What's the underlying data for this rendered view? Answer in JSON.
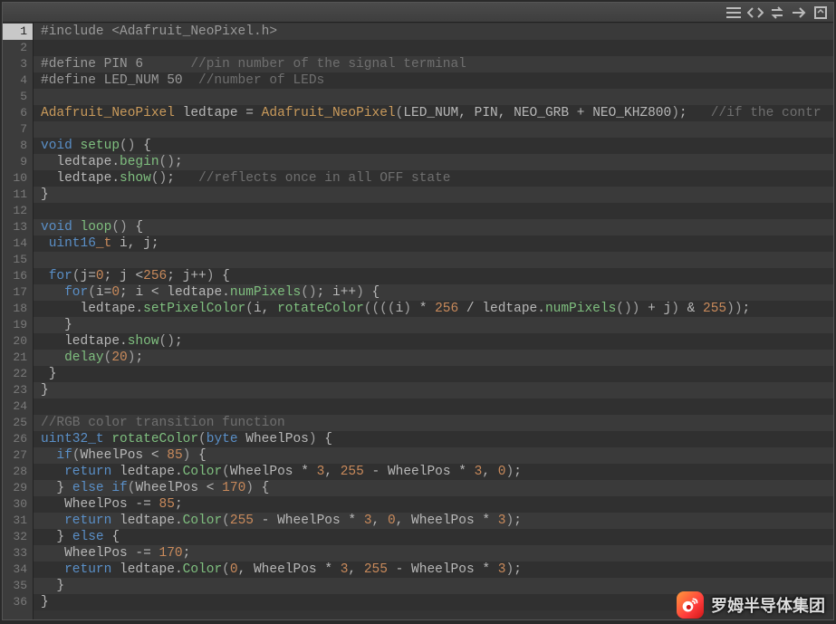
{
  "toolbar": {
    "icons": [
      "hamburger-icon",
      "code-icon",
      "swap-icon",
      "arrow-right-icon",
      "expand-icon"
    ]
  },
  "watermark": {
    "text": "罗姆半导体集团"
  },
  "code": {
    "lines": [
      {
        "n": 1,
        "hl": true,
        "tokens": [
          [
            "directive",
            "#include "
          ],
          [
            "string",
            "<Adafruit_NeoPixel.h>"
          ]
        ]
      },
      {
        "n": 2,
        "tokens": []
      },
      {
        "n": 3,
        "tokens": [
          [
            "directive",
            "#define PIN 6      "
          ],
          [
            "comment",
            "//pin number of the signal terminal"
          ]
        ]
      },
      {
        "n": 4,
        "tokens": [
          [
            "directive",
            "#define LED_NUM 50  "
          ],
          [
            "comment",
            "//number of LEDs"
          ]
        ]
      },
      {
        "n": 5,
        "tokens": []
      },
      {
        "n": 6,
        "tokens": [
          [
            "type",
            "Adafruit_NeoPixel"
          ],
          [
            "ident",
            " ledtape "
          ],
          [
            "op",
            "= "
          ],
          [
            "type",
            "Adafruit_NeoPixel"
          ],
          [
            "paren",
            "("
          ],
          [
            "ident",
            "LED_NUM"
          ],
          [
            "punct",
            ", "
          ],
          [
            "ident",
            "PIN"
          ],
          [
            "punct",
            ", "
          ],
          [
            "ident",
            "NEO_GRB "
          ],
          [
            "op",
            "+ "
          ],
          [
            "ident",
            "NEO_KHZ800"
          ],
          [
            "paren",
            ")"
          ],
          [
            "punct",
            ";   "
          ],
          [
            "comment",
            "//if the contr"
          ]
        ]
      },
      {
        "n": 7,
        "tokens": []
      },
      {
        "n": 8,
        "tokens": [
          [
            "keyword",
            "void"
          ],
          [
            "ident",
            " "
          ],
          [
            "func",
            "setup"
          ],
          [
            "paren",
            "()"
          ],
          [
            "punct",
            " {"
          ]
        ]
      },
      {
        "n": 9,
        "tokens": [
          [
            "ident",
            "  ledtape"
          ],
          [
            "punct",
            "."
          ],
          [
            "method",
            "begin"
          ],
          [
            "paren",
            "()"
          ],
          [
            "punct",
            ";"
          ]
        ]
      },
      {
        "n": 10,
        "tokens": [
          [
            "ident",
            "  ledtape"
          ],
          [
            "punct",
            "."
          ],
          [
            "method",
            "show"
          ],
          [
            "paren",
            "()"
          ],
          [
            "punct",
            ";   "
          ],
          [
            "comment",
            "//reflects once in all OFF state"
          ]
        ]
      },
      {
        "n": 11,
        "tokens": [
          [
            "punct",
            "}"
          ]
        ]
      },
      {
        "n": 12,
        "tokens": []
      },
      {
        "n": 13,
        "tokens": [
          [
            "keyword",
            "void"
          ],
          [
            "ident",
            " "
          ],
          [
            "func",
            "loop"
          ],
          [
            "paren",
            "()"
          ],
          [
            "punct",
            " {"
          ]
        ]
      },
      {
        "n": 14,
        "tokens": [
          [
            "keyword",
            " uint16"
          ],
          [
            "orange",
            "_t"
          ],
          [
            "ident",
            " i"
          ],
          [
            "punct",
            ", "
          ],
          [
            "ident",
            "j"
          ],
          [
            "punct",
            ";"
          ]
        ]
      },
      {
        "n": 15,
        "tokens": []
      },
      {
        "n": 16,
        "tokens": [
          [
            "keyword",
            " for"
          ],
          [
            "paren",
            "("
          ],
          [
            "ident",
            "j"
          ],
          [
            "op",
            "="
          ],
          [
            "number",
            "0"
          ],
          [
            "punct",
            "; "
          ],
          [
            "ident",
            "j "
          ],
          [
            "op",
            "<"
          ],
          [
            "number",
            "256"
          ],
          [
            "punct",
            "; "
          ],
          [
            "ident",
            "j"
          ],
          [
            "op",
            "++"
          ],
          [
            "paren",
            ")"
          ],
          [
            "punct",
            " {"
          ]
        ]
      },
      {
        "n": 17,
        "tokens": [
          [
            "keyword",
            "   for"
          ],
          [
            "paren",
            "("
          ],
          [
            "ident",
            "i"
          ],
          [
            "op",
            "="
          ],
          [
            "number",
            "0"
          ],
          [
            "punct",
            "; "
          ],
          [
            "ident",
            "i "
          ],
          [
            "op",
            "< "
          ],
          [
            "ident",
            "ledtape"
          ],
          [
            "punct",
            "."
          ],
          [
            "method",
            "numPixels"
          ],
          [
            "paren",
            "()"
          ],
          [
            "punct",
            "; "
          ],
          [
            "ident",
            "i"
          ],
          [
            "op",
            "++"
          ],
          [
            "paren",
            ")"
          ],
          [
            "punct",
            " {"
          ]
        ]
      },
      {
        "n": 18,
        "tokens": [
          [
            "ident",
            "     ledtape"
          ],
          [
            "punct",
            "."
          ],
          [
            "method",
            "setPixelColor"
          ],
          [
            "paren",
            "("
          ],
          [
            "ident",
            "i"
          ],
          [
            "punct",
            ", "
          ],
          [
            "method",
            "rotateColor"
          ],
          [
            "paren",
            "(((("
          ],
          [
            "ident",
            "i"
          ],
          [
            "paren",
            ")"
          ],
          [
            "op",
            " * "
          ],
          [
            "number",
            "256"
          ],
          [
            "op",
            " / "
          ],
          [
            "ident",
            "ledtape"
          ],
          [
            "punct",
            "."
          ],
          [
            "method",
            "numPixels"
          ],
          [
            "paren",
            "())"
          ],
          [
            "op",
            " + "
          ],
          [
            "ident",
            "j"
          ],
          [
            "paren",
            ")"
          ],
          [
            "op",
            " & "
          ],
          [
            "number",
            "255"
          ],
          [
            "paren",
            "))"
          ],
          [
            "punct",
            ";"
          ]
        ]
      },
      {
        "n": 19,
        "tokens": [
          [
            "punct",
            "   }"
          ]
        ]
      },
      {
        "n": 20,
        "tokens": [
          [
            "ident",
            "   ledtape"
          ],
          [
            "punct",
            "."
          ],
          [
            "method",
            "show"
          ],
          [
            "paren",
            "()"
          ],
          [
            "punct",
            ";"
          ]
        ]
      },
      {
        "n": 21,
        "tokens": [
          [
            "ident",
            "   "
          ],
          [
            "method",
            "delay"
          ],
          [
            "paren",
            "("
          ],
          [
            "number",
            "20"
          ],
          [
            "paren",
            ")"
          ],
          [
            "punct",
            ";"
          ]
        ]
      },
      {
        "n": 22,
        "tokens": [
          [
            "punct",
            " }"
          ]
        ]
      },
      {
        "n": 23,
        "tokens": [
          [
            "punct",
            "}"
          ]
        ]
      },
      {
        "n": 24,
        "tokens": []
      },
      {
        "n": 25,
        "tokens": [
          [
            "comment",
            "//RGB color transition function"
          ]
        ]
      },
      {
        "n": 26,
        "tokens": [
          [
            "keyword",
            "uint32_t"
          ],
          [
            "ident",
            " "
          ],
          [
            "func",
            "rotateColor"
          ],
          [
            "paren",
            "("
          ],
          [
            "keyword",
            "byte"
          ],
          [
            "ident",
            " WheelPos"
          ],
          [
            "paren",
            ")"
          ],
          [
            "punct",
            " {"
          ]
        ]
      },
      {
        "n": 27,
        "tokens": [
          [
            "keyword",
            "  if"
          ],
          [
            "paren",
            "("
          ],
          [
            "ident",
            "WheelPos "
          ],
          [
            "op",
            "< "
          ],
          [
            "number",
            "85"
          ],
          [
            "paren",
            ")"
          ],
          [
            "punct",
            " {"
          ]
        ]
      },
      {
        "n": 28,
        "tokens": [
          [
            "keyword",
            "   return"
          ],
          [
            "ident",
            " ledtape"
          ],
          [
            "punct",
            "."
          ],
          [
            "method",
            "Color"
          ],
          [
            "paren",
            "("
          ],
          [
            "ident",
            "WheelPos "
          ],
          [
            "op",
            "* "
          ],
          [
            "number",
            "3"
          ],
          [
            "punct",
            ", "
          ],
          [
            "number",
            "255"
          ],
          [
            "op",
            " - "
          ],
          [
            "ident",
            "WheelPos "
          ],
          [
            "op",
            "* "
          ],
          [
            "number",
            "3"
          ],
          [
            "punct",
            ", "
          ],
          [
            "number",
            "0"
          ],
          [
            "paren",
            ")"
          ],
          [
            "punct",
            ";"
          ]
        ]
      },
      {
        "n": 29,
        "tokens": [
          [
            "punct",
            "  } "
          ],
          [
            "keyword",
            "else if"
          ],
          [
            "paren",
            "("
          ],
          [
            "ident",
            "WheelPos "
          ],
          [
            "op",
            "< "
          ],
          [
            "number",
            "170"
          ],
          [
            "paren",
            ")"
          ],
          [
            "punct",
            " {"
          ]
        ]
      },
      {
        "n": 30,
        "tokens": [
          [
            "ident",
            "   WheelPos "
          ],
          [
            "op",
            "-= "
          ],
          [
            "number",
            "85"
          ],
          [
            "punct",
            ";"
          ]
        ]
      },
      {
        "n": 31,
        "tokens": [
          [
            "keyword",
            "   return"
          ],
          [
            "ident",
            " ledtape"
          ],
          [
            "punct",
            "."
          ],
          [
            "method",
            "Color"
          ],
          [
            "paren",
            "("
          ],
          [
            "number",
            "255"
          ],
          [
            "op",
            " - "
          ],
          [
            "ident",
            "WheelPos "
          ],
          [
            "op",
            "* "
          ],
          [
            "number",
            "3"
          ],
          [
            "punct",
            ", "
          ],
          [
            "number",
            "0"
          ],
          [
            "punct",
            ", "
          ],
          [
            "ident",
            "WheelPos "
          ],
          [
            "op",
            "* "
          ],
          [
            "number",
            "3"
          ],
          [
            "paren",
            ")"
          ],
          [
            "punct",
            ";"
          ]
        ]
      },
      {
        "n": 32,
        "tokens": [
          [
            "punct",
            "  } "
          ],
          [
            "keyword",
            "else"
          ],
          [
            "punct",
            " {"
          ]
        ]
      },
      {
        "n": 33,
        "tokens": [
          [
            "ident",
            "   WheelPos "
          ],
          [
            "op",
            "-= "
          ],
          [
            "number",
            "170"
          ],
          [
            "punct",
            ";"
          ]
        ]
      },
      {
        "n": 34,
        "tokens": [
          [
            "keyword",
            "   return"
          ],
          [
            "ident",
            " ledtape"
          ],
          [
            "punct",
            "."
          ],
          [
            "method",
            "Color"
          ],
          [
            "paren",
            "("
          ],
          [
            "number",
            "0"
          ],
          [
            "punct",
            ", "
          ],
          [
            "ident",
            "WheelPos "
          ],
          [
            "op",
            "* "
          ],
          [
            "number",
            "3"
          ],
          [
            "punct",
            ", "
          ],
          [
            "number",
            "255"
          ],
          [
            "op",
            " - "
          ],
          [
            "ident",
            "WheelPos "
          ],
          [
            "op",
            "* "
          ],
          [
            "number",
            "3"
          ],
          [
            "paren",
            ")"
          ],
          [
            "punct",
            ";"
          ]
        ]
      },
      {
        "n": 35,
        "tokens": [
          [
            "punct",
            "  }"
          ]
        ]
      },
      {
        "n": 36,
        "tokens": [
          [
            "punct",
            "}"
          ]
        ]
      }
    ]
  }
}
